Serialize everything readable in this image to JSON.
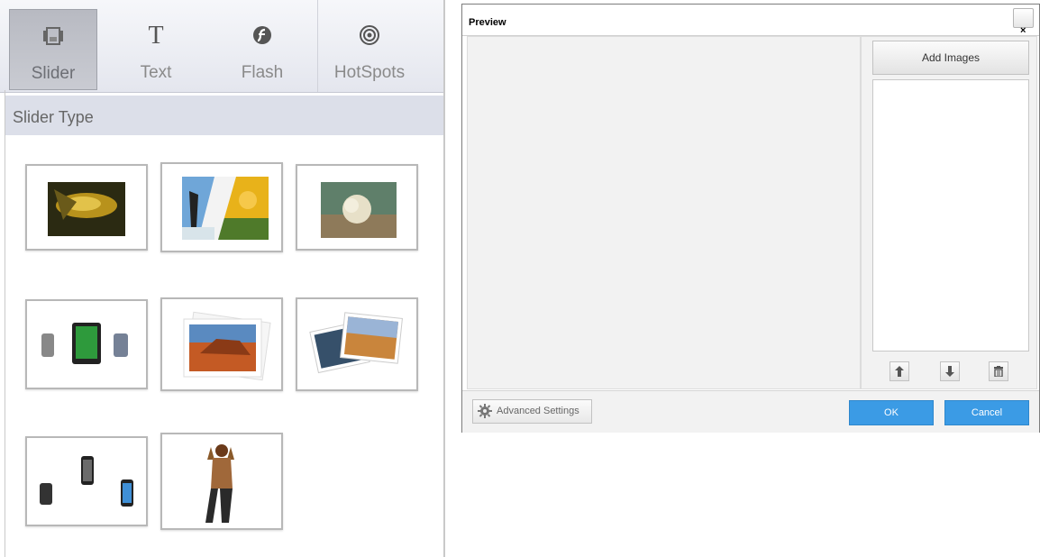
{
  "toolbar": {
    "tools": [
      {
        "label": "Slider",
        "icon": "slider-icon",
        "active": true
      },
      {
        "label": "Text",
        "icon": "text-icon",
        "active": false
      },
      {
        "label": "Flash",
        "icon": "flash-icon",
        "active": false
      },
      {
        "label": "HotSpots",
        "icon": "hotspots-icon",
        "active": false
      }
    ]
  },
  "slider_panel": {
    "header": "Slider Type",
    "thumbnails": [
      {
        "name": "slider-type-yellow-flower"
      },
      {
        "name": "slider-type-page-curl"
      },
      {
        "name": "slider-type-fade-flower"
      },
      {
        "name": "slider-type-device-carousel"
      },
      {
        "name": "slider-type-photo-stack"
      },
      {
        "name": "slider-type-photo-scatter"
      },
      {
        "name": "slider-type-phone-3d"
      },
      {
        "name": "slider-type-cutout-person"
      }
    ]
  },
  "dialog": {
    "title": "Preview",
    "close_symbol": "×",
    "add_images_label": "Add Images",
    "list_buttons": [
      "move-up-icon",
      "move-down-icon",
      "delete-icon"
    ],
    "advanced_settings_label": "Advanced Settings",
    "ok_label": "OK",
    "cancel_label": "Cancel"
  },
  "colors": {
    "accent_button": "#3b9be5",
    "section_header_bg": "#dcdfe9",
    "toolbar_active_bg": "#bfc1c8"
  }
}
